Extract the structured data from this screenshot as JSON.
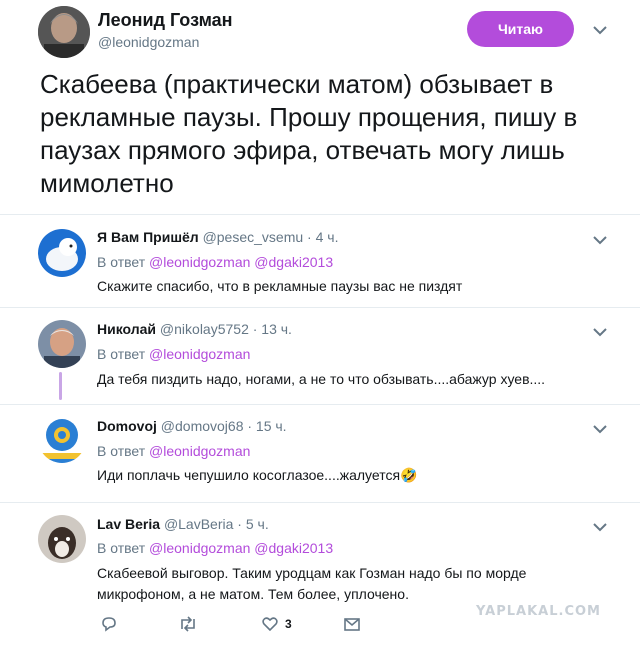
{
  "main": {
    "name": "Леонид Гозман",
    "handle": "@leonidgozman",
    "follow_label": "Читаю",
    "text": "Скабеева (практически матом) обзывает в рекламные паузы. Прошу прощения, пишу в паузах прямого эфира, отвечать могу лишь мимолетно"
  },
  "replies": [
    {
      "name": "Я Вам Пришёл",
      "handle": "@pesec_vsemu",
      "time": "· 4 ч.",
      "in_reply_prefix": "В ответ",
      "mentions": "@leonidgozman @dgaki2013",
      "text": "Скажите спасибо, что в рекламные паузы вас не пиздят"
    },
    {
      "name": "Николай",
      "handle": "@nikolay5752",
      "time": "· 13 ч.",
      "in_reply_prefix": "В ответ",
      "mentions": "@leonidgozman",
      "text": "Да тебя пиздить надо, ногами, а не то что обзывать....абажур хуев...."
    },
    {
      "name": "Domovoj",
      "handle": "@domovoj68",
      "time": "· 15 ч.",
      "in_reply_prefix": "В ответ",
      "mentions": "@leonidgozman",
      "text": "Иди поплачь чепушило косоглазое....жалуется🤣"
    },
    {
      "name": "Lav Beria",
      "handle": "@LavBeria",
      "time": "· 5 ч.",
      "in_reply_prefix": "В ответ",
      "mentions": "@leonidgozman @dgaki2013",
      "text": "Скабеевой выговор. Таким уродцам как Гозман надо бы по морде микрофоном, а не матом. Тем более, уплочено."
    }
  ],
  "actions": {
    "like_count": "3"
  },
  "watermark": "YAPLAKAL.COM",
  "colors": {
    "accent": "#b34cdb",
    "secondary_text": "#657786",
    "divider": "#e6ecf0"
  },
  "icons": [
    "chevron-down-icon",
    "reply-icon",
    "retweet-icon",
    "like-icon",
    "message-icon"
  ]
}
